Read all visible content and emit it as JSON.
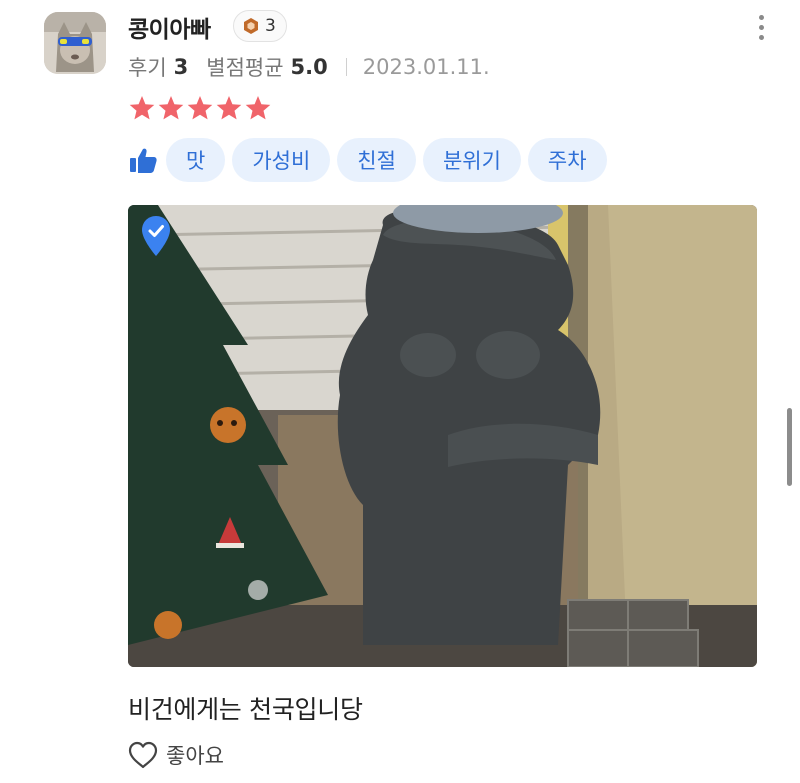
{
  "review": {
    "username": "콩이아빠",
    "level": "3",
    "review_label": "후기",
    "review_count": "3",
    "rating_label": "별점평균",
    "rating_avg": "5.0",
    "date": "2023.01.11.",
    "rating_stars": 5,
    "star_color": "#f0646a",
    "tags": [
      "맛",
      "가성비",
      "친절",
      "분위기",
      "주차"
    ],
    "tag_bg": "#e8f1fd",
    "tag_color": "#2f6fd6",
    "text": "비건에게는 천국입니당",
    "like_label": "좋아요"
  }
}
